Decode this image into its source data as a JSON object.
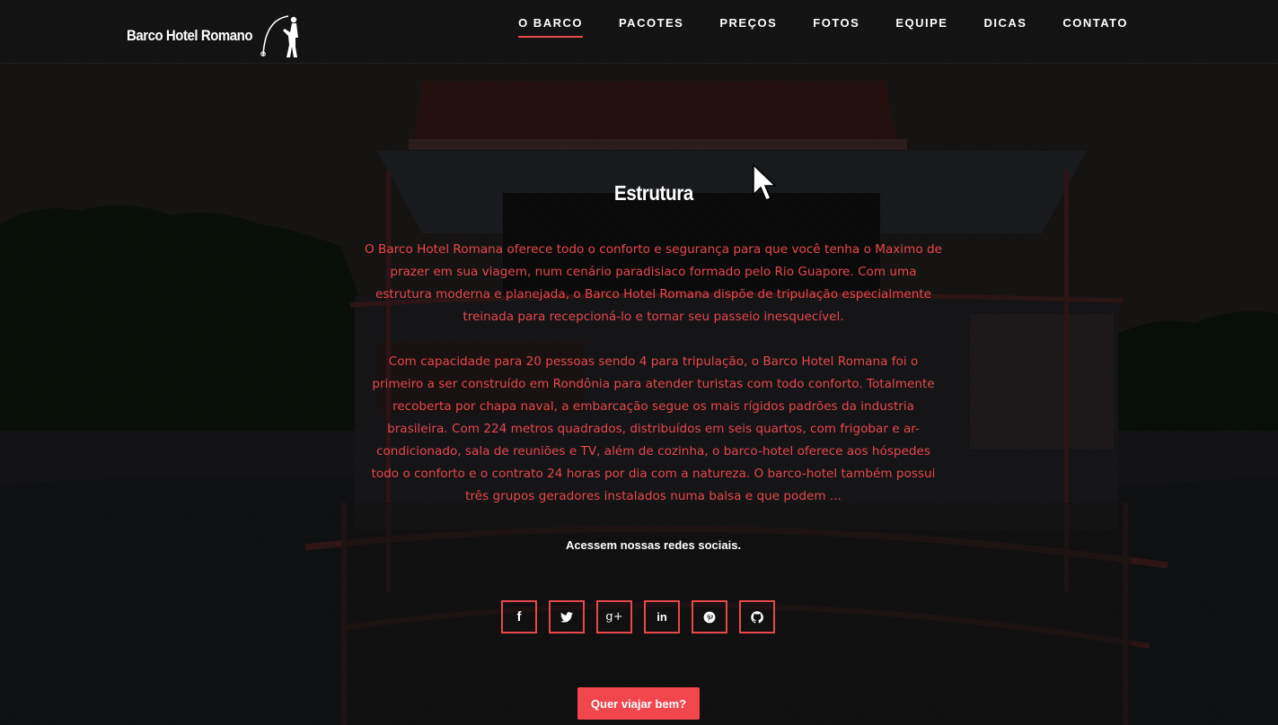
{
  "brand": {
    "name": "Barco Hotel Romano",
    "logo_icon": "fisherman-icon"
  },
  "nav": {
    "items": [
      {
        "label": "O BARCO",
        "active": true
      },
      {
        "label": "PACOTES"
      },
      {
        "label": "PREÇOS"
      },
      {
        "label": "FOTOS"
      },
      {
        "label": "EQUIPE"
      },
      {
        "label": "DICAS"
      },
      {
        "label": "CONTATO"
      }
    ]
  },
  "section": {
    "title": "Estrutura",
    "paragraphs": [
      "O Barco Hotel Romana oferece todo o conforto e segurança para que você tenha o Maximo de prazer em sua viagem, num cenário paradisiaco formado pelo Rio Guapore. Com uma estrutura moderna e planejada, o Barco Hotel Romana dispõe de tripulação especialmente treinada para recepcioná-lo e tornar seu passeio inesquecível.",
      "Com capacidade para 20 pessoas sendo 4 para tripulação, o Barco Hotel Romana foi o primeiro a ser construído em Rondônia para atender turistas com todo conforto. Totalmente recoberta por chapa naval, a embarcação segue os mais rígidos padrões da industria brasileira. Com 224 metros quadrados, distribuídos em seis quartos, com frigobar e ar-condicionado, sala de reuniões e TV, além de cozinha, o barco-hotel oferece aos hóspedes todo o conforto e o contrato 24 horas por dia com a natureza. O barco-hotel também possui três grupos geradores instalados numa balsa e que podem ..."
    ],
    "social_caption": "Acessem nossas redes sociais."
  },
  "social": [
    {
      "icon": "facebook-icon",
      "glyph": "f"
    },
    {
      "icon": "twitter-icon"
    },
    {
      "icon": "google-plus-icon",
      "glyph": "g+"
    },
    {
      "icon": "linkedin-icon",
      "glyph": "in"
    },
    {
      "icon": "pinterest-icon"
    },
    {
      "icon": "github-icon"
    }
  ],
  "cta": {
    "label": "Quer viajar bem?"
  },
  "colors": {
    "accent": "#e8474c",
    "button": "#f0464c",
    "text": "#ffffff"
  }
}
